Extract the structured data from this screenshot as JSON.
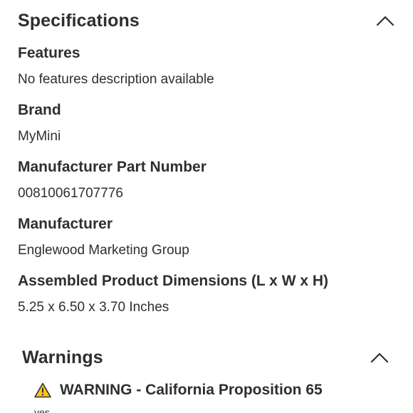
{
  "specifications": {
    "title": "Specifications",
    "collapse_icon": "chevron-up-icon",
    "items": [
      {
        "label": "Features",
        "value": "No features description available"
      },
      {
        "label": "Brand",
        "value": "MyMini"
      },
      {
        "label": "Manufacturer Part Number",
        "value": "00810061707776"
      },
      {
        "label": "Manufacturer",
        "value": "Englewood Marketing Group"
      },
      {
        "label": "Assembled Product Dimensions (L x W x H)",
        "value": "5.25 x 6.50 x 3.70 Inches"
      }
    ]
  },
  "warnings": {
    "title": "Warnings",
    "collapse_icon": "chevron-up-icon",
    "warning_icon": "warning-triangle-icon",
    "warning_icon_color": "#ffc220",
    "warning_title": "WARNING - California Proposition 65",
    "cut_off_text": "yes"
  }
}
